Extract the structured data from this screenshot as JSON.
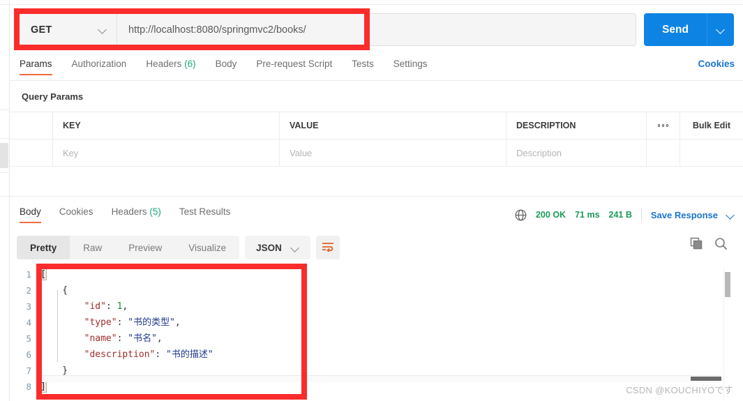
{
  "request": {
    "method": "GET",
    "url": "http://localhost:8080/springmvc2/books/",
    "send_label": "Send",
    "tabs": [
      {
        "label": "Params",
        "count": ""
      },
      {
        "label": "Authorization",
        "count": ""
      },
      {
        "label": "Headers",
        "count": "(6)"
      },
      {
        "label": "Body",
        "count": ""
      },
      {
        "label": "Pre-request Script",
        "count": ""
      },
      {
        "label": "Tests",
        "count": ""
      },
      {
        "label": "Settings",
        "count": ""
      }
    ],
    "cookies_link": "Cookies"
  },
  "query_params": {
    "section_title": "Query Params",
    "columns": [
      "KEY",
      "VALUE",
      "DESCRIPTION"
    ],
    "bulk_edit_label": "Bulk Edit",
    "rows": [
      {
        "key_placeholder": "Key",
        "value_placeholder": "Value",
        "description_placeholder": "Description"
      }
    ]
  },
  "response": {
    "tabs": [
      {
        "label": "Body",
        "count": ""
      },
      {
        "label": "Cookies",
        "count": ""
      },
      {
        "label": "Headers",
        "count": "(5)"
      },
      {
        "label": "Test Results",
        "count": ""
      }
    ],
    "status": "200 OK",
    "time": "71 ms",
    "size": "241 B",
    "save_response_label": "Save Response",
    "format_tabs": [
      "Pretty",
      "Raw",
      "Preview",
      "Visualize"
    ],
    "format_active": "Pretty",
    "language": "JSON",
    "body_lines": [
      {
        "n": "1",
        "segments": [
          {
            "t": "[",
            "c": "bracket-hl"
          }
        ]
      },
      {
        "n": "2",
        "segments": [
          {
            "t": "    {",
            "c": "p"
          }
        ]
      },
      {
        "n": "3",
        "segments": [
          {
            "t": "        ",
            "c": "p"
          },
          {
            "t": "\"id\"",
            "c": "k"
          },
          {
            "t": ": ",
            "c": "p"
          },
          {
            "t": "1",
            "c": "n"
          },
          {
            "t": ",",
            "c": "p"
          }
        ]
      },
      {
        "n": "4",
        "segments": [
          {
            "t": "        ",
            "c": "p"
          },
          {
            "t": "\"type\"",
            "c": "k"
          },
          {
            "t": ": ",
            "c": "p"
          },
          {
            "t": "\"书的类型\"",
            "c": "s"
          },
          {
            "t": ",",
            "c": "p"
          }
        ]
      },
      {
        "n": "5",
        "segments": [
          {
            "t": "        ",
            "c": "p"
          },
          {
            "t": "\"name\"",
            "c": "k"
          },
          {
            "t": ": ",
            "c": "p"
          },
          {
            "t": "\"书名\"",
            "c": "s"
          },
          {
            "t": ",",
            "c": "p"
          }
        ]
      },
      {
        "n": "6",
        "segments": [
          {
            "t": "        ",
            "c": "p"
          },
          {
            "t": "\"description\"",
            "c": "k"
          },
          {
            "t": ": ",
            "c": "p"
          },
          {
            "t": "\"书的描述\"",
            "c": "s"
          }
        ]
      },
      {
        "n": "7",
        "segments": [
          {
            "t": "    }",
            "c": "p"
          }
        ]
      },
      {
        "n": "8",
        "segments": [
          {
            "t": "]",
            "c": "bracket-hl"
          }
        ]
      }
    ]
  },
  "colors": {
    "accent_orange": "#ef6c3e",
    "send_blue": "#0d84e3",
    "link_blue": "#1a75d2",
    "status_green": "#1b9a59",
    "annotation_red": "#fb2c2c"
  },
  "watermark": "CSDN @KOUCHIYOです"
}
